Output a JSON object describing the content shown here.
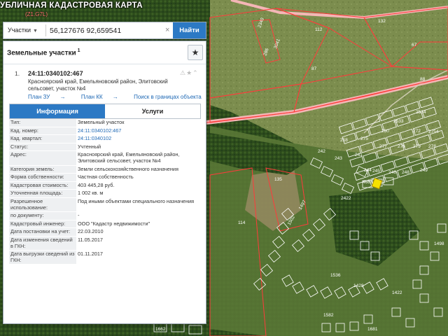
{
  "app": {
    "title": "УБЛИЧНАЯ КАДАСТРОВАЯ КАРТА",
    "subtitle": "(Z1.G7L)"
  },
  "search": {
    "type_label": "Участки",
    "query": "56,127676 92,659541",
    "clear_symbol": "×",
    "button_label": "Найти"
  },
  "panel": {
    "title": "Земельные участки",
    "title_count": "1",
    "star_symbol": "★",
    "result": {
      "index": "1.",
      "cad_number": "24:11:0340102:467",
      "address": "Красноярский край, Емельяновский район, Элитовский сельсовет, участок №4",
      "icons": "⚠★⌃",
      "links": [
        {
          "label": "План ЗУ",
          "arrow": "→"
        },
        {
          "label": "План КК",
          "arrow": "→"
        },
        {
          "label": "Поиск в границах объекта",
          "arrow": "→"
        }
      ]
    },
    "tabs": {
      "info": "Информация",
      "services": "Услуги"
    },
    "rows": [
      {
        "key": "Тип:",
        "value": "Земельный участок"
      },
      {
        "key": "Кад. номер:",
        "value": "24:11:0340102:467"
      },
      {
        "key": "Кад. квартал:",
        "value": "24:11:0340102"
      },
      {
        "key": "Статус:",
        "value": "Учтенный"
      },
      {
        "key": "Адрес:",
        "value": "Красноярский край, Емельяновский район, Элитовский сельсовет, участок №4"
      },
      {
        "key": "Категория земель:",
        "value": "Земли сельскохозяйственного назначения"
      },
      {
        "key": "Форма собственности:",
        "value": "Частная собственность"
      },
      {
        "key": "Кадастровая стоимость:",
        "value": "403 445,28 руб."
      },
      {
        "key": "Уточненная площадь:",
        "value": "1 002 кв. м"
      },
      {
        "key": "Разрешенное использование:",
        "value": "Под иными объектами специального назначения"
      },
      {
        "key": "по документу:",
        "value": "-"
      },
      {
        "key": "Кадастровый инженер:",
        "value": "ООО \"Кадастр недвижимости\""
      },
      {
        "key": "Дата постановки на учет:",
        "value": "22.03.2010"
      },
      {
        "key": "Дата изменения сведений в ГКН:",
        "value": "11.05.2017"
      },
      {
        "key": "Дата выгрузки сведений из ГКН:",
        "value": "01.11.2017"
      }
    ]
  },
  "map": {
    "labels": [
      "132",
      "112",
      "67",
      "87",
      "88",
      "2340",
      "3041",
      "286",
      "2534",
      "2533",
      "260",
      "272",
      "2754",
      "258",
      "275",
      "277",
      "276",
      "279",
      "278",
      "242",
      "243",
      "241",
      "244",
      "246",
      "245",
      "248",
      "249",
      "466",
      "135",
      "114",
      "2422",
      "1497",
      "1502",
      "1498",
      "1536",
      "1428",
      "1422",
      "1582",
      "1681",
      "1662"
    ],
    "colors": {
      "parcel_line": "#ff3b3b",
      "road": "#f4b6b6",
      "selected": "#f5e100"
    }
  }
}
